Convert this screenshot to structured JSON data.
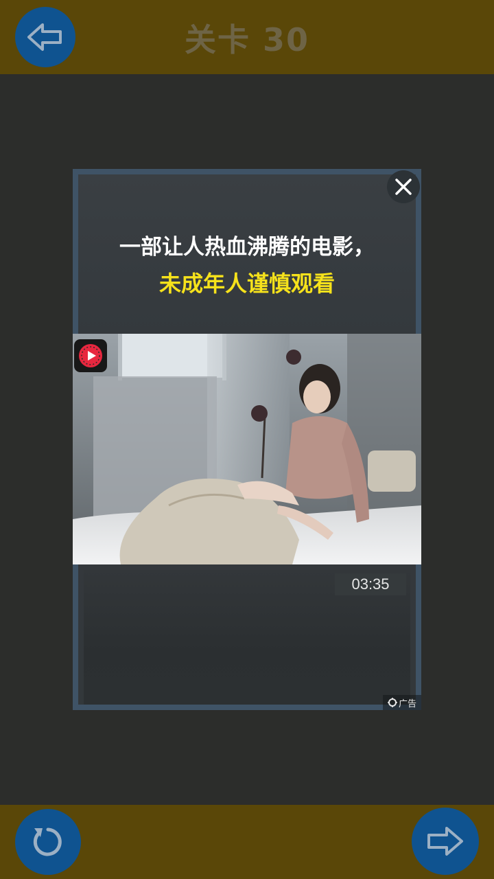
{
  "header": {
    "title": "关卡 30",
    "back_icon": "arrow-left-icon",
    "background_color": "#5a4708"
  },
  "ad": {
    "headline_line1": "一部让人热血沸腾的电影，",
    "headline_line2": "未成年人谨慎观看",
    "headline_line2_color": "#f6e21b",
    "video_duration": "03:35",
    "ad_label": "广告",
    "close_icon": "close-icon",
    "app_icon": "watermelon-video-icon"
  },
  "footer": {
    "reset_icon": "reset-icon",
    "next_icon": "arrow-right-icon",
    "button_color": "#0f5390"
  }
}
